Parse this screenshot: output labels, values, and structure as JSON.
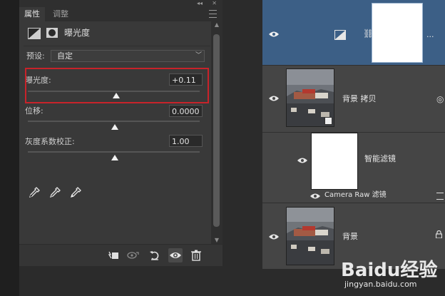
{
  "properties_panel": {
    "tabs": [
      {
        "label": "属性"
      },
      {
        "label": "调整"
      }
    ],
    "heading": "曝光度",
    "preset_label": "预设:",
    "preset_value": "自定",
    "rows": [
      {
        "label": "曝光度:",
        "value": "+0.11",
        "slider_position": 0.5
      },
      {
        "label": "位移:",
        "value": "0.0000",
        "slider_position": 0.5
      },
      {
        "label": "灰度系数校正:",
        "value": "1.00",
        "slider_position": 0.5
      }
    ],
    "eyedroppers": [
      "eyedropper-black-icon",
      "eyedropper-gray-icon",
      "eyedropper-white-icon"
    ],
    "bottom_toolbar": [
      "clip-to-layer-icon",
      "view-previous-state-icon",
      "reset-icon",
      "visibility-eye-icon",
      "trash-icon"
    ]
  },
  "layers": [
    {
      "name": "",
      "type": "exposure-adjustment",
      "selected": true
    },
    {
      "name": "背景 拷贝",
      "type": "smart-object"
    },
    {
      "name": "智能滤镜",
      "type": "smart-filter-mask"
    },
    {
      "name": "Camera Raw 滤镜",
      "type": "filter"
    },
    {
      "name": "背景",
      "type": "background",
      "locked": true
    }
  ],
  "layer_ellipsis": "...",
  "watermark": {
    "text": "Baidu经验",
    "sub": "jingyan.baidu.com"
  },
  "colors": {
    "selection": "#3c5f86",
    "highlight": "#c8232a",
    "panel": "#393939"
  }
}
